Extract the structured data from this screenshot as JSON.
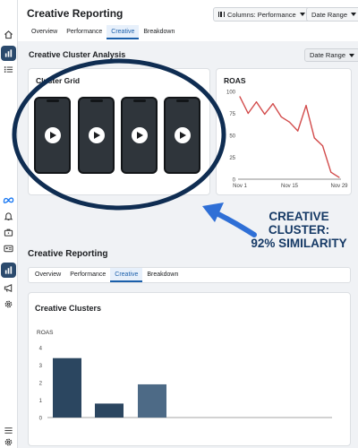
{
  "header": {
    "title": "Creative Reporting",
    "columns_label": "Columns: Performance",
    "date_range_label": "Date Range",
    "tabs": [
      {
        "label": "Overview",
        "active": false
      },
      {
        "label": "Performance",
        "active": false
      },
      {
        "label": "Creative",
        "active": true
      },
      {
        "label": "Breakdown",
        "active": false
      }
    ]
  },
  "analysis": {
    "title": "Creative Cluster Analysis",
    "date_range_label": "Date Range",
    "cluster_grid": {
      "title": "Cluster Grid",
      "thumbnails": [
        {
          "icon": "play-icon"
        },
        {
          "icon": "play-icon"
        },
        {
          "icon": "play-icon"
        },
        {
          "icon": "play-icon"
        }
      ]
    },
    "roas_card": {
      "title": "ROAS"
    }
  },
  "annotation": {
    "text": "CREATIVE\nCLUSTER:\n92% SIMILARITY",
    "color": "#163a66",
    "circle_color": "#0f2d52",
    "arrow_color": "#2f6fd6"
  },
  "second_section": {
    "title": "Creative Reporting",
    "tabs": [
      {
        "label": "Overview",
        "active": false
      },
      {
        "label": "Performance",
        "active": false
      },
      {
        "label": "Creative",
        "active": true
      },
      {
        "label": "Breakdown",
        "active": false
      }
    ],
    "clusters_card": {
      "title": "Creative Clusters"
    }
  },
  "sidebar": {
    "icons": [
      {
        "name": "home-icon",
        "active": false
      },
      {
        "name": "bar-chart-icon",
        "active": true
      },
      {
        "name": "list-icon",
        "active": false
      },
      {
        "name": "meta-logo-icon",
        "active": false
      },
      {
        "name": "bell-icon",
        "active": false
      },
      {
        "name": "briefcase-icon",
        "active": false
      },
      {
        "name": "id-card-icon",
        "active": false
      },
      {
        "name": "bar-chart-icon",
        "active": true
      },
      {
        "name": "megaphone-icon",
        "active": false
      },
      {
        "name": "gear-icon",
        "active": false
      },
      {
        "name": "menu-icon",
        "active": false
      },
      {
        "name": "gear-icon",
        "active": false
      }
    ]
  },
  "colors": {
    "accent": "#1b5faa",
    "active_rail": "#2b4a6d",
    "line_series": "#d24b4b",
    "bar_dark": "#2b4660",
    "bar_light": "#4d6a86"
  },
  "chart_data": [
    {
      "type": "line",
      "title": "ROAS",
      "x": [
        "Nov 1",
        "Nov 4",
        "Nov 7",
        "Nov 10",
        "Nov 13",
        "Nov 16",
        "Nov 19",
        "Nov 21",
        "Nov 23",
        "Nov 25",
        "Nov 27",
        "Nov 29"
      ],
      "xticks": [
        "Nov 1",
        "Nov 15",
        "Nov 29"
      ],
      "series": [
        {
          "values": [
            94,
            75,
            88,
            74,
            86,
            71,
            65,
            55,
            84,
            47,
            38,
            8,
            2
          ]
        }
      ],
      "ylim": [
        0,
        100
      ],
      "yticks": [
        0,
        25,
        50,
        75,
        100
      ],
      "grid": false
    },
    {
      "type": "bar",
      "title": "Creative Clusters",
      "ylabel": "ROAS",
      "categories": [
        "",
        "",
        ""
      ],
      "values": [
        3.4,
        0.8,
        1.9
      ],
      "ylim": [
        0,
        4
      ],
      "yticks": [
        0,
        1,
        2,
        3,
        4
      ],
      "bar_colors": [
        "#2b4660",
        "#2b4660",
        "#4d6a86"
      ],
      "grid": false
    }
  ]
}
